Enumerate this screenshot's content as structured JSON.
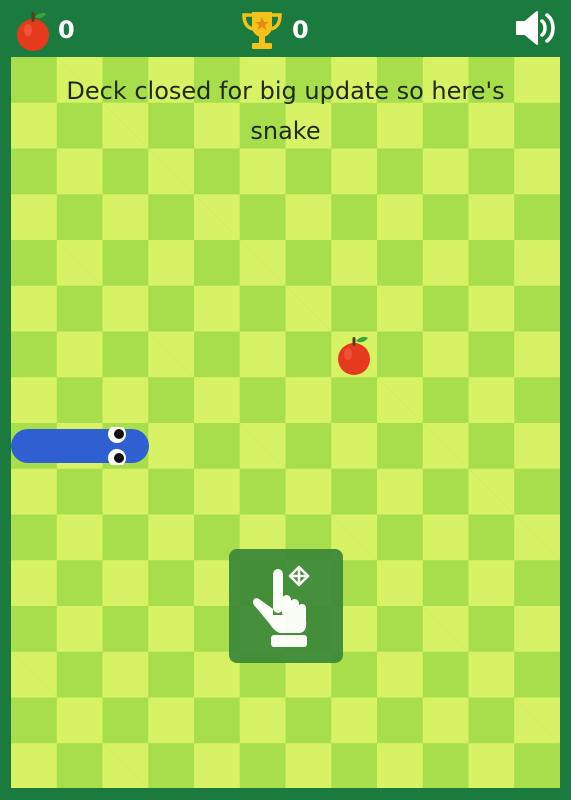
{
  "hud": {
    "apples": "0",
    "best": "0",
    "icons": {
      "apple": "apple-icon",
      "trophy": "trophy-icon",
      "sound": "speaker-icon"
    }
  },
  "board": {
    "message": "Deck closed for big update so here's snake",
    "colors": {
      "light_square": "#d7f264",
      "dark_square": "#a8de4c",
      "frame": "#1b7a3e",
      "snake": "#2f5fd0",
      "apple": "#e53a1e"
    }
  },
  "hint": {
    "icon": "swipe-hand-icon"
  }
}
